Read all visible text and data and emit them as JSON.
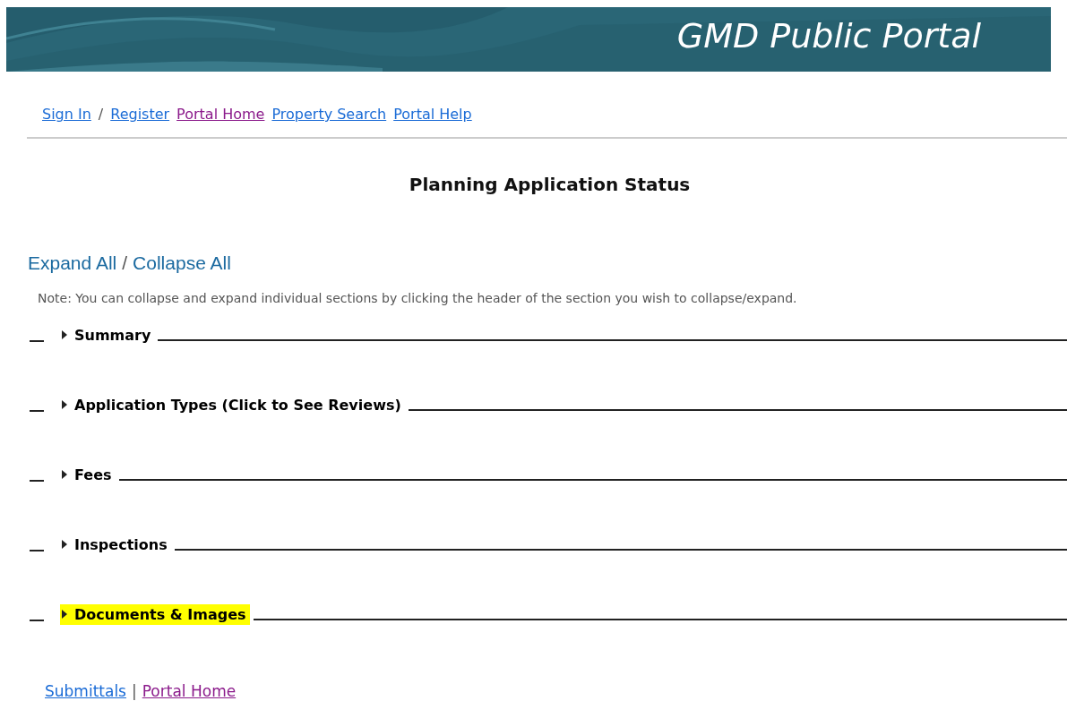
{
  "banner": {
    "title": "GMD Public Portal"
  },
  "nav": [
    {
      "kind": "link",
      "label": "Sign In",
      "visited": false
    },
    {
      "kind": "separator",
      "label": "/"
    },
    {
      "kind": "link",
      "label": "Register",
      "visited": false
    },
    {
      "kind": "link",
      "label": "Portal Home",
      "visited": true
    },
    {
      "kind": "link",
      "label": "Property Search",
      "visited": false
    },
    {
      "kind": "link",
      "label": "Portal Help",
      "visited": false
    }
  ],
  "page_title": "Planning Application Status",
  "toggle_links": [
    {
      "kind": "link",
      "label": "Expand All"
    },
    {
      "kind": "separator",
      "label": "/"
    },
    {
      "kind": "link",
      "label": "Collapse All"
    }
  ],
  "note": "Note: You can collapse and expand individual sections by clicking the header of the section you wish to collapse/expand.",
  "sections": [
    {
      "title": "Summary",
      "highlighted": false
    },
    {
      "title": "Application Types (Click to See Reviews)",
      "highlighted": false
    },
    {
      "title": "Fees",
      "highlighted": false
    },
    {
      "title": "Inspections",
      "highlighted": false
    },
    {
      "title": "Documents & Images",
      "highlighted": true
    }
  ],
  "footer": [
    {
      "kind": "link",
      "label": "Submittals",
      "visited": false
    },
    {
      "kind": "separator",
      "label": "|"
    },
    {
      "kind": "link",
      "label": "Portal Home",
      "visited": true
    }
  ]
}
